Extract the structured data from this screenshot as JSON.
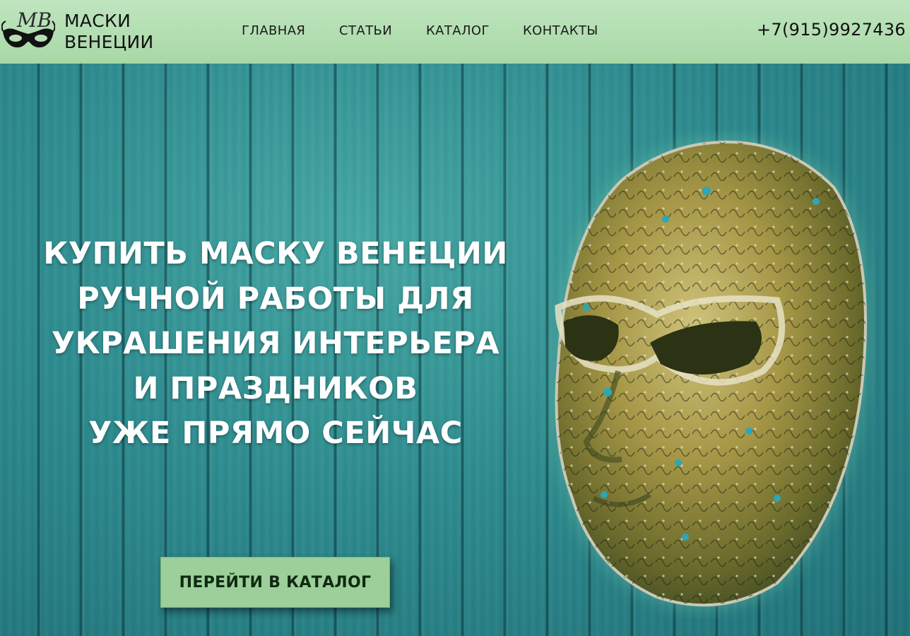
{
  "header": {
    "logo_monogram": "МВ",
    "logo_line1": "МАСКИ",
    "logo_line2": "ВЕНЕЦИИ",
    "nav": [
      {
        "label": "ГЛАВНАЯ"
      },
      {
        "label": "СТАТЬИ"
      },
      {
        "label": "КАТАЛОГ"
      },
      {
        "label": "КОНТАКТЫ"
      }
    ],
    "phone": "+7(915)9927436"
  },
  "hero": {
    "headline_lines": [
      "КУПИТЬ МАСКУ ВЕНЕЦИИ",
      "РУЧНОЙ РАБОТЫ ДЛЯ",
      "УКРАШЕНИЯ ИНТЕРЬЕРА",
      "И ПРАЗДНИКОВ",
      "УЖЕ ПРЯМО СЕЙЧАС"
    ],
    "cta_label": "ПЕРЕЙТИ В КАТАЛОГ"
  },
  "colors": {
    "header_bg": "#bfe5bf",
    "hero_bg": "#2f8a8c",
    "cta_bg": "#9ccf9a",
    "mask_gold": "#a89a4a"
  },
  "images": {
    "mask": "venetian-full-face-mask"
  }
}
